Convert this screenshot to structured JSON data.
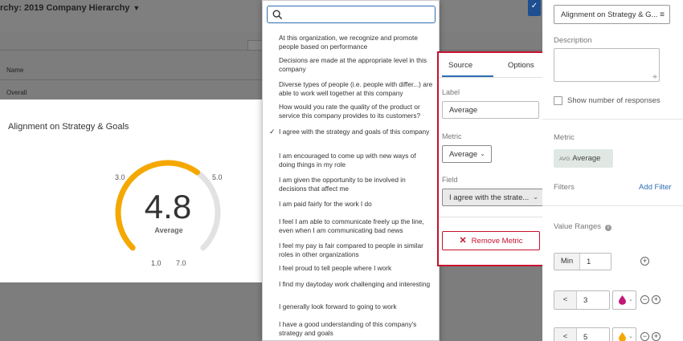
{
  "background": {
    "hierarchy_title": "rchy:  2019 Company Hierarchy",
    "table_name_header": "Name",
    "table_overall_row": "Overall"
  },
  "widget": {
    "title": "Alignment on Strategy & Goals",
    "value": "4.8",
    "value_label": "Average",
    "scale_labels": {
      "low_outer": "1.0",
      "low_inner": "3.0",
      "high_inner": "5.0",
      "high_outer": "7.0"
    },
    "gauge": {
      "min": 1.0,
      "max": 7.0,
      "value": 4.8,
      "fill_color": "#f5a800",
      "track_color": "#e2e2e2"
    }
  },
  "dropdown": {
    "search_placeholder": "",
    "search_value": "",
    "options": [
      {
        "label": "At this organization, we recognize and promote people based on performance",
        "selected": false
      },
      {
        "label": "Decisions are made at the appropriate level in this company",
        "selected": false
      },
      {
        "label": "Diverse types of people (i.e. people with differ...) are able to work well together at this company",
        "selected": false
      },
      {
        "label": "How would you rate the quality of the product or service this company provides to its customers?",
        "selected": false
      },
      {
        "label": "I agree with the strategy and goals of this company",
        "selected": true
      },
      {
        "label": "I am encouraged to come up with new ways of doing things in my role",
        "selected": false
      },
      {
        "label": "I am given the opportunity to be involved in decisions that affect me",
        "selected": false
      },
      {
        "label": "I am paid fairly for the work I do",
        "selected": false
      },
      {
        "label": "I feel I am able to communicate freely up the line, even when I am communicating bad news",
        "selected": false
      },
      {
        "label": "I feel my pay is fair compared to people in similar roles in other organizations",
        "selected": false
      },
      {
        "label": "I feel proud to tell people where I work",
        "selected": false
      },
      {
        "label": "I find my daytoday work challenging and interesting",
        "selected": false
      },
      {
        "label": "I generally look forward to going to work",
        "selected": false
      },
      {
        "label": "I have a good understanding of this company's strategy and goals",
        "selected": false
      }
    ]
  },
  "metric_panel": {
    "tabs": [
      "Source",
      "Options"
    ],
    "active_tab": "Source",
    "label_caption": "Label",
    "label_value": "Average",
    "metric_caption": "Metric",
    "metric_value": "Average",
    "field_caption": "Field",
    "field_value": "I agree with the strate...",
    "remove_label": "Remove Metric",
    "highlight_color": "#c8102e"
  },
  "sidebar": {
    "widget_select": "Alignment on Strategy & G...",
    "description_label": "Description",
    "show_responses_label": "Show number of responses",
    "metric_label": "Metric",
    "metric_chip_prefix": "AVG",
    "metric_chip_value": "Average",
    "filters_label": "Filters",
    "add_filter_label": "Add Filter",
    "value_ranges_label": "Value Ranges",
    "min_prefix": "Min",
    "min_value": "1",
    "ranges": [
      {
        "prefix": "<",
        "value": "3",
        "color": "#c2187a"
      },
      {
        "prefix": "<",
        "value": "5",
        "color": "#f5a800"
      }
    ]
  }
}
